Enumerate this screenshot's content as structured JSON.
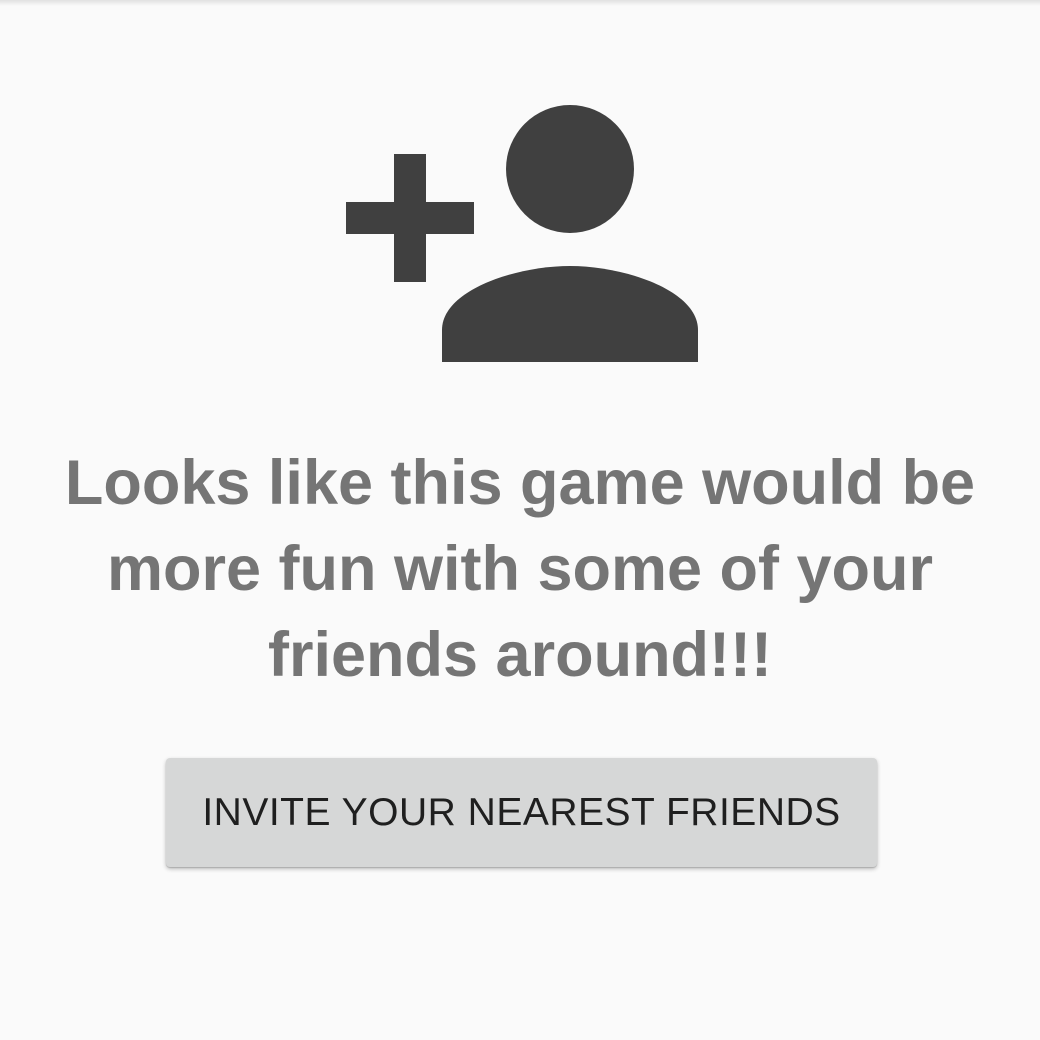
{
  "empty_state": {
    "icon": "person-add-icon",
    "icon_color": "#404040",
    "message": "Looks like this game would be more fun with some of your friends around!!!",
    "message_color": "#757575"
  },
  "invite_button": {
    "label": "INVITE YOUR NEAREST FRIENDS",
    "background_color": "#d6d7d7",
    "text_color": "#1f1f1f"
  },
  "background_color": "#fafafa"
}
